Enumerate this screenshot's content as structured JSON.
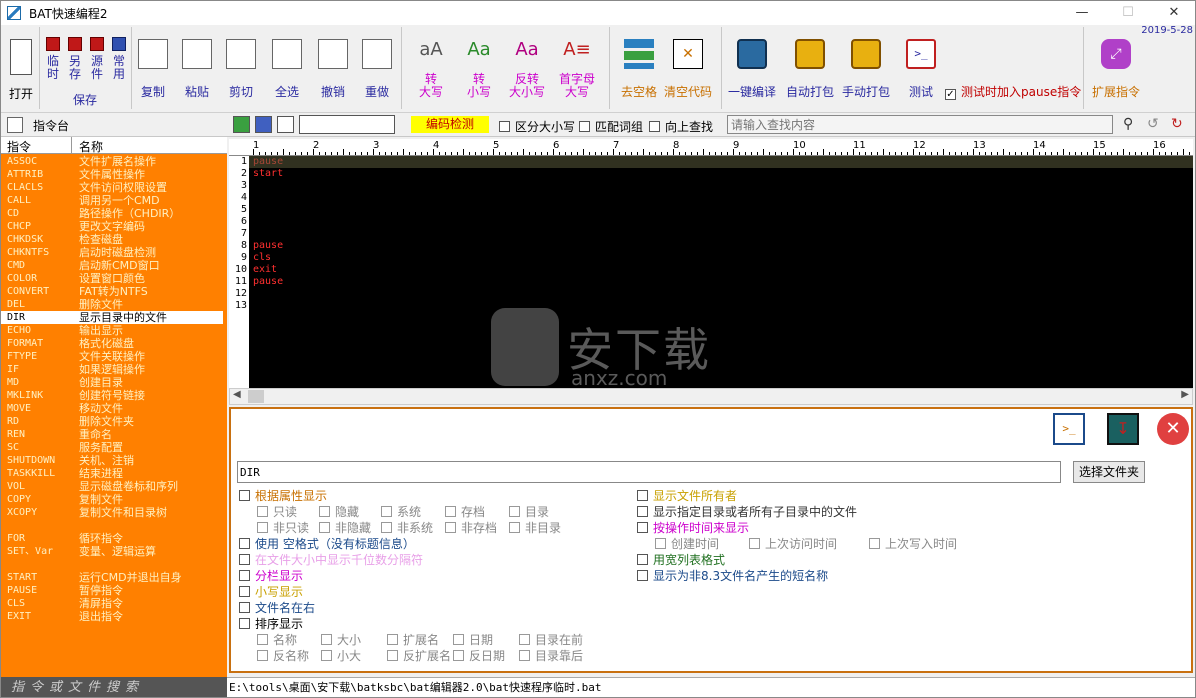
{
  "window": {
    "title": "BAT快速编程2",
    "date": "2019-5-28"
  },
  "ribbon": {
    "open": "打开",
    "temp_save": "临\n时",
    "save_as": "另\n存",
    "source_file": "源\n件",
    "common": "常\n用",
    "save_group": "保存",
    "copy": "复制",
    "paste": "粘贴",
    "cut": "剪切",
    "select_all": "全选",
    "undo": "撤销",
    "redo": "重做",
    "to_upper": "转\n大写",
    "to_lower": "转\n小写",
    "invert_case": "反转\n大小写",
    "capitalize": "首字母\n大写",
    "remove_spaces": "去空格",
    "clear_code": "清空代码",
    "compile": "一键编译",
    "auto_pack": "自动打包",
    "manual_pack": "手动打包",
    "test": "测试",
    "test_pause_label": "测试时加入pause指令",
    "extend": "扩展指令"
  },
  "cmdbar": {
    "console_label": "指令台",
    "encoding_check": "编码检测",
    "case_sensitive": "区分大小写",
    "match_word": "匹配词组",
    "search_up": "向上查找",
    "search_placeholder": "请输入查找内容"
  },
  "left_panel": {
    "col_cmd": "指令",
    "col_name": "名称",
    "items": [
      {
        "k": "ASSOC",
        "d": "文件扩展名操作"
      },
      {
        "k": "ATTRIB",
        "d": "文件属性操作"
      },
      {
        "k": "CLACLS",
        "d": "文件访问权限设置"
      },
      {
        "k": "CALL",
        "d": "调用另一个CMD"
      },
      {
        "k": "CD",
        "d": "路径操作（CHDIR）"
      },
      {
        "k": "CHCP",
        "d": "更改文字编码"
      },
      {
        "k": "CHKDSK",
        "d": "检查磁盘"
      },
      {
        "k": "CHKNTFS",
        "d": "启动时磁盘检测"
      },
      {
        "k": "CMD",
        "d": "启动新CMD窗口"
      },
      {
        "k": "COLOR",
        "d": "设置窗口颜色"
      },
      {
        "k": "CONVERT",
        "d": "FAT转为NTFS"
      },
      {
        "k": "DEL",
        "d": "删除文件"
      },
      {
        "k": "DIR",
        "d": "显示目录中的文件"
      },
      {
        "k": "ECHO",
        "d": "输出显示"
      },
      {
        "k": "FORMAT",
        "d": "格式化磁盘"
      },
      {
        "k": "FTYPE",
        "d": "文件关联操作"
      },
      {
        "k": "IF",
        "d": "如果逻辑操作"
      },
      {
        "k": "MD",
        "d": "创建目录"
      },
      {
        "k": "MKLINK",
        "d": "创建符号链接"
      },
      {
        "k": "MOVE",
        "d": "移动文件"
      },
      {
        "k": "RD",
        "d": "删除文件夹"
      },
      {
        "k": "REN",
        "d": "重命名"
      },
      {
        "k": "SC",
        "d": "服务配置"
      },
      {
        "k": "SHUTDOWN",
        "d": "关机、注销"
      },
      {
        "k": "TASKKILL",
        "d": "结束进程"
      },
      {
        "k": "VOL",
        "d": "显示磁盘卷标和序列"
      },
      {
        "k": "COPY",
        "d": "复制文件"
      },
      {
        "k": "XCOPY",
        "d": "复制文件和目录树"
      },
      {
        "k": "",
        "d": ""
      },
      {
        "k": "FOR",
        "d": "循环指令"
      },
      {
        "k": "SET、Var",
        "d": "变量、逻辑运算"
      },
      {
        "k": "",
        "d": ""
      },
      {
        "k": "START",
        "d": "运行CMD并退出自身"
      },
      {
        "k": "PAUSE",
        "d": "暂停指令"
      },
      {
        "k": "CLS",
        "d": "清屏指令"
      },
      {
        "k": "EXIT",
        "d": "退出指令"
      }
    ],
    "selected_index": 12,
    "search_label": "指令或文件搜索"
  },
  "editor": {
    "ruler": [
      "1",
      "2",
      "3",
      "4",
      "5",
      "6",
      "7",
      "8",
      "9",
      "10",
      "11",
      "12",
      "13",
      "14",
      "15",
      "16"
    ],
    "lines": [
      "pause",
      "start",
      "",
      "",
      "",
      "",
      "",
      "pause",
      "cls",
      "exit",
      "pause",
      "",
      ""
    ]
  },
  "bottom": {
    "command_value": "DIR",
    "choose_folder": "选择文件夹",
    "by_attr": "根据属性显示",
    "readonly": "只读",
    "hidden": "隐藏",
    "system": "系统",
    "archive": "存档",
    "directory": "目录",
    "not_readonly": "非只读",
    "not_hidden": "非隐藏",
    "not_system": "非系统",
    "not_archive": "非存档",
    "not_directory": "非目录",
    "use_empty": "使用  空格式（没有标题信息）",
    "thousands": "在文件大小中显示千位数分隔符",
    "columns": "分栏显示",
    "lowercase": "小写显示",
    "name_right": "文件名在右",
    "sort": "排序显示",
    "s_name": "名称",
    "s_size": "大小",
    "s_ext": "扩展名",
    "s_date": "日期",
    "s_dirfirst": "目录在前",
    "s_rname": "反名称",
    "s_rsize": "小大",
    "s_rext": "反扩展名",
    "s_rdate": "反日期",
    "s_dirlast": "目录靠后",
    "show_owner": "显示文件所有者",
    "show_subdirs": "显示指定目录或者所有子目录中的文件",
    "by_time": "按操作时间来显示",
    "t_create": "创建时间",
    "t_access": "上次访问时间",
    "t_write": "上次写入时间",
    "wide": "用宽列表格式",
    "short_name": "显示为非8.3文件名产生的短名称"
  },
  "statusbar": {
    "path": "E:\\tools\\桌面\\安下载\\batksbc\\bat编辑器2.0\\bat快速程序临时.bat"
  },
  "watermark": {
    "text": "安下载",
    "sub": "anxz.com"
  },
  "colors": {
    "left_bg": "#ff8000",
    "accent": "#2a2aa0",
    "code_red": "#ff3030",
    "magenta": "#cc00cc"
  }
}
